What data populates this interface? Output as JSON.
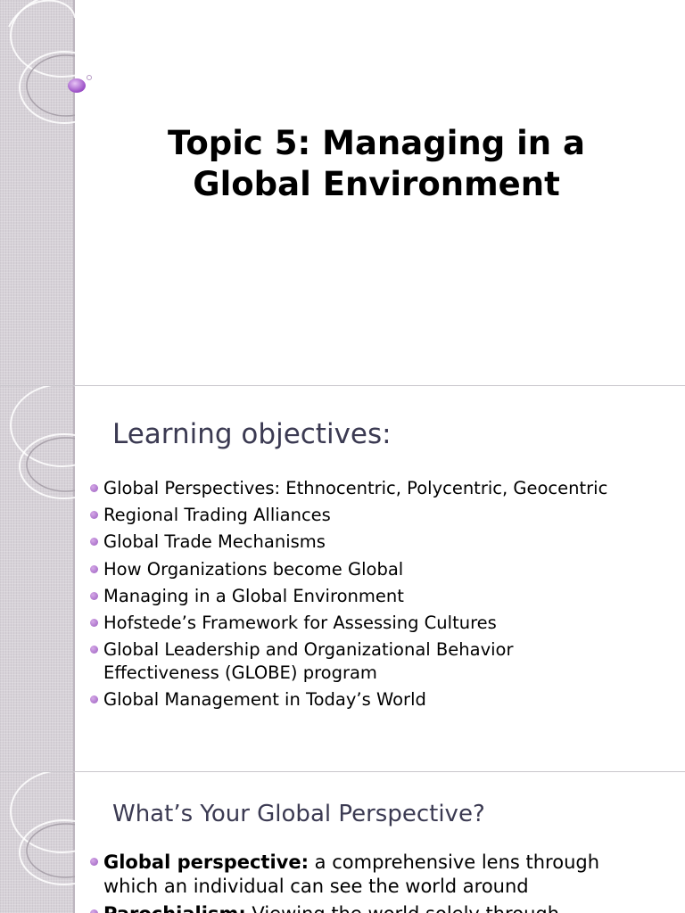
{
  "slide1": {
    "title_line1": "Topic 5: Managing in a",
    "title_line2": "Global Environment"
  },
  "slide2": {
    "heading": "Learning objectives:",
    "items": [
      [
        "Global Perspectives: Ethnocentric, Polycentric, Geocentric"
      ],
      [
        "Regional Trading Alliances"
      ],
      [
        "Global Trade Mechanisms"
      ],
      [
        "How Organizations become Global"
      ],
      [
        "Managing in a Global Environment"
      ],
      [
        "Hofstede’s Framework for Assessing Cultures"
      ],
      [
        "Global Leadership and Organizational Behavior",
        "Effectiveness (GLOBE) program"
      ],
      [
        "Global Management in Today’s World"
      ]
    ]
  },
  "slide3": {
    "heading": "What’s Your Global Perspective?",
    "items": [
      {
        "term": "Global perspective:",
        "line1_rest": " a comprehensive lens through",
        "line2": "which an individual can see the world around"
      },
      {
        "term": "Parochialism:",
        "line1_rest": " Viewing the world solely through"
      }
    ]
  },
  "colors": {
    "accent_purple": "#9b5fbf",
    "heading_text": "#3b3a52",
    "sidebar": "#d7d2d8"
  }
}
